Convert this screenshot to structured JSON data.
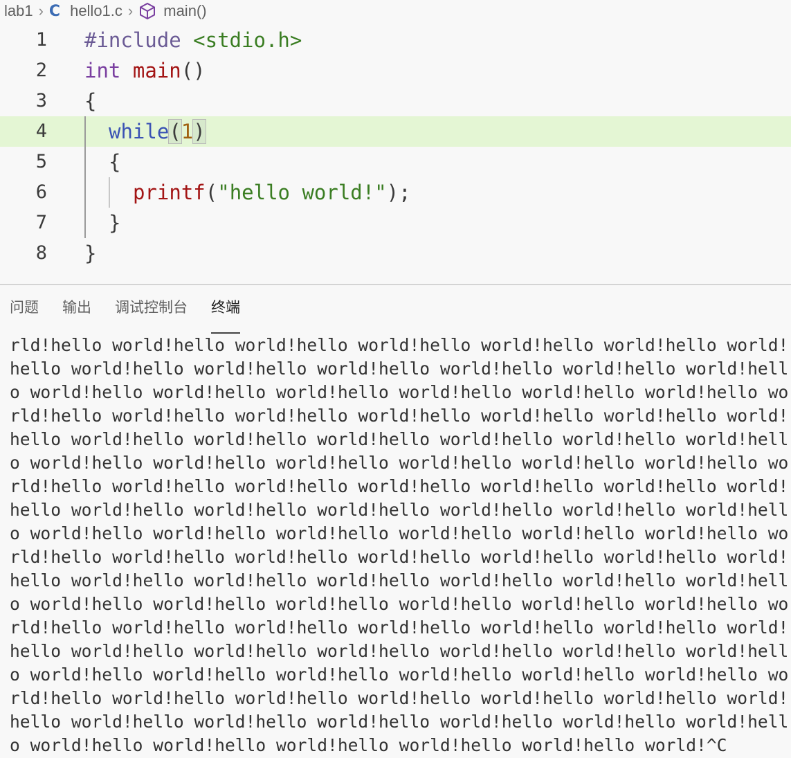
{
  "breadcrumb": {
    "folder": "lab1",
    "file": "hello1.c",
    "file_icon": "C",
    "symbol": "main()"
  },
  "editor": {
    "highlighted_line": 4,
    "lines": [
      {
        "num": "1"
      },
      {
        "num": "2"
      },
      {
        "num": "3"
      },
      {
        "num": "4"
      },
      {
        "num": "5"
      },
      {
        "num": "6"
      },
      {
        "num": "7"
      },
      {
        "num": "8"
      }
    ],
    "code": {
      "l1_directive": "#include",
      "l1_header": "<stdio.h>",
      "l2_type": "int",
      "l2_fn": "main",
      "l2_parens": "()",
      "l3": "{",
      "l4_kw": "while",
      "l4_open": "(",
      "l4_num": "1",
      "l4_close": ")",
      "l5": "{",
      "l6_fn": "printf",
      "l6_open": "(",
      "l6_str": "\"hello world!\"",
      "l6_end": ");",
      "l7": "}",
      "l8": "}"
    }
  },
  "panel": {
    "tabs": [
      "问题",
      "输出",
      "调试控制台",
      "终端"
    ],
    "active_tab": "终端"
  },
  "terminal": {
    "lines": [
      "rld!hello world!hello world!hello world!hello world!hello world!hello world!",
      "hello world!hello world!hello world!hello world!hello world!hello world!hell",
      "o world!hello world!hello world!hello world!hello world!hello world!hello wo",
      "rld!hello world!hello world!hello world!hello world!hello world!hello world!",
      "hello world!hello world!hello world!hello world!hello world!hello world!hell",
      "o world!hello world!hello world!hello world!hello world!hello world!hello wo",
      "rld!hello world!hello world!hello world!hello world!hello world!hello world!",
      "hello world!hello world!hello world!hello world!hello world!hello world!hell",
      "o world!hello world!hello world!hello world!hello world!hello world!hello wo",
      "rld!hello world!hello world!hello world!hello world!hello world!hello world!",
      "hello world!hello world!hello world!hello world!hello world!hello world!hell",
      "o world!hello world!hello world!hello world!hello world!hello world!hello wo",
      "rld!hello world!hello world!hello world!hello world!hello world!hello world!",
      "hello world!hello world!hello world!hello world!hello world!hello world!hell",
      "o world!hello world!hello world!hello world!hello world!hello world!hello wo",
      "rld!hello world!hello world!hello world!hello world!hello world!hello world!",
      "hello world!hello world!hello world!hello world!hello world!hello world!hell",
      "o world!hello world!hello world!hello world!hello world!hello world!^C"
    ]
  }
}
